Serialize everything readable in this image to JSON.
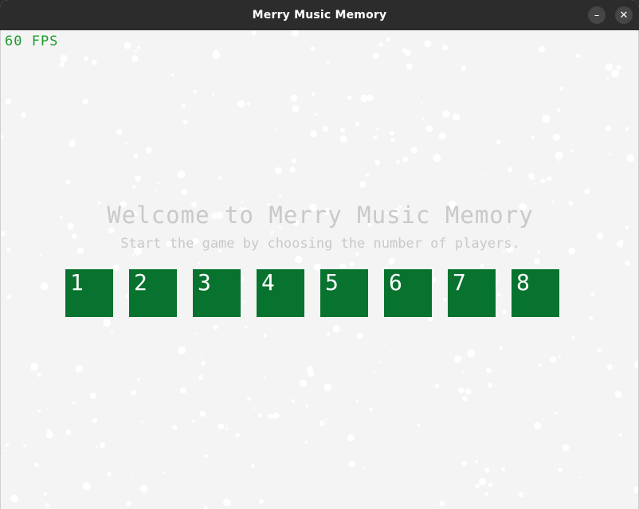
{
  "window": {
    "title": "Merry Music Memory",
    "minimize_glyph": "–",
    "close_glyph": "✕"
  },
  "hud": {
    "fps": "60 FPS"
  },
  "menu": {
    "title": "Welcome to Merry Music Memory",
    "subtitle": "Start the game by choosing the number of players.",
    "player_options": [
      "1",
      "2",
      "3",
      "4",
      "5",
      "6",
      "7",
      "8"
    ]
  },
  "colors": {
    "background": "#f4f4f4",
    "button": "#07732f",
    "fps_text": "#1a9a2a",
    "menu_text": "#c9c9c9",
    "snow": "#ffffff"
  }
}
